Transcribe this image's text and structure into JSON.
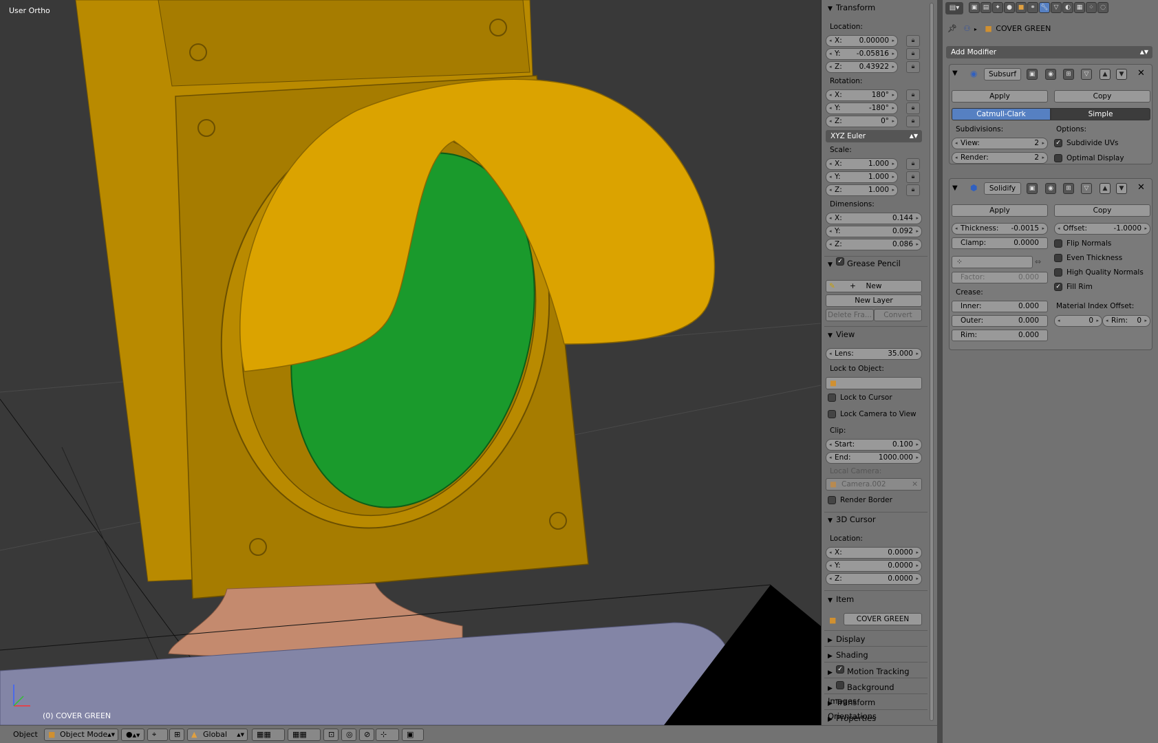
{
  "viewport": {
    "view_name": "User Ortho",
    "object_label": "(0) COVER GREEN"
  },
  "npanel": {
    "transform": {
      "title": "Transform",
      "location_label": "Location:",
      "location": [
        {
          "axis": "X:",
          "value": "0.00000"
        },
        {
          "axis": "Y:",
          "value": "-0.05816"
        },
        {
          "axis": "Z:",
          "value": "0.43922"
        }
      ],
      "rotation_label": "Rotation:",
      "rotation": [
        {
          "axis": "X:",
          "value": "180°"
        },
        {
          "axis": "Y:",
          "value": "-180°"
        },
        {
          "axis": "Z:",
          "value": "0°"
        }
      ],
      "rotation_mode": "XYZ Euler",
      "scale_label": "Scale:",
      "scale": [
        {
          "axis": "X:",
          "value": "1.000"
        },
        {
          "axis": "Y:",
          "value": "1.000"
        },
        {
          "axis": "Z:",
          "value": "1.000"
        }
      ],
      "dimensions_label": "Dimensions:",
      "dimensions": [
        {
          "axis": "X:",
          "value": "0.144"
        },
        {
          "axis": "Y:",
          "value": "0.092"
        },
        {
          "axis": "Z:",
          "value": "0.086"
        }
      ]
    },
    "grease_pencil": {
      "title": "Grease Pencil",
      "new_label": "New",
      "new_layer_label": "New Layer",
      "delete_frame_label": "Delete Fra...",
      "convert_label": "Convert"
    },
    "view": {
      "title": "View",
      "lens_label": "Lens:",
      "lens_value": "35.000",
      "lock_to_object_label": "Lock to Object:",
      "lock_to_cursor": "Lock to Cursor",
      "lock_camera_to_view": "Lock Camera to View",
      "clip_label": "Clip:",
      "clip_start_label": "Start:",
      "clip_start": "0.100",
      "clip_end_label": "End:",
      "clip_end": "1000.000",
      "local_camera_label": "Local Camera:",
      "local_camera": "Camera.002",
      "render_border": "Render Border"
    },
    "cursor": {
      "title": "3D Cursor",
      "location_label": "Location:",
      "location": [
        {
          "axis": "X:",
          "value": "0.0000"
        },
        {
          "axis": "Y:",
          "value": "0.0000"
        },
        {
          "axis": "Z:",
          "value": "0.0000"
        }
      ]
    },
    "item": {
      "title": "Item",
      "name": "COVER GREEN"
    },
    "collapsed_panels": [
      "Display",
      "Shading",
      "Motion Tracking",
      "Background Images",
      "Transform Orientations",
      "Properties"
    ]
  },
  "properties": {
    "object_name": "COVER GREEN",
    "add_modifier_label": "Add Modifier",
    "subsurf": {
      "name": "Subsurf",
      "apply_label": "Apply",
      "copy_label": "Copy",
      "mode_catmull": "Catmull-Clark",
      "mode_simple": "Simple",
      "subdivisions_label": "Subdivisions:",
      "view_label": "View:",
      "view_value": "2",
      "render_label": "Render:",
      "render_value": "2",
      "options_label": "Options:",
      "subdivide_uvs": "Subdivide UVs",
      "optimal_display": "Optimal Display"
    },
    "solidify": {
      "name": "Solidify",
      "apply_label": "Apply",
      "copy_label": "Copy",
      "thickness_label": "Thickness:",
      "thickness_value": "-0.0015",
      "offset_label": "Offset:",
      "offset_value": "-1.0000",
      "clamp_label": "Clamp:",
      "clamp_value": "0.0000",
      "flip_normals": "Flip Normals",
      "even_thickness": "Even Thickness",
      "high_quality_normals": "High Quality Normals",
      "fill_rim": "Fill Rim",
      "factor_label": "Factor:",
      "factor_value": "0.000",
      "crease_label": "Crease:",
      "inner_label": "Inner:",
      "inner_value": "0.000",
      "outer_label": "Outer:",
      "outer_value": "0.000",
      "rim_label": "Rim:",
      "rim_value": "0.000",
      "material_index_offset_label": "Material Index Offset:",
      "material_offset_value": "0",
      "material_rim_label": "Rim:",
      "material_rim_value": "0"
    }
  },
  "bottombar": {
    "menu_object": "Object",
    "mode": "Object Mode",
    "orientation": "Global"
  },
  "colors": {
    "accent_blue": "#5680c2",
    "housing_yellow": "#d9a100",
    "lens_green": "#1a9a2c",
    "base_tan": "#c48a6e",
    "viewport_bg": "#393939",
    "panel_bg": "#727272"
  }
}
